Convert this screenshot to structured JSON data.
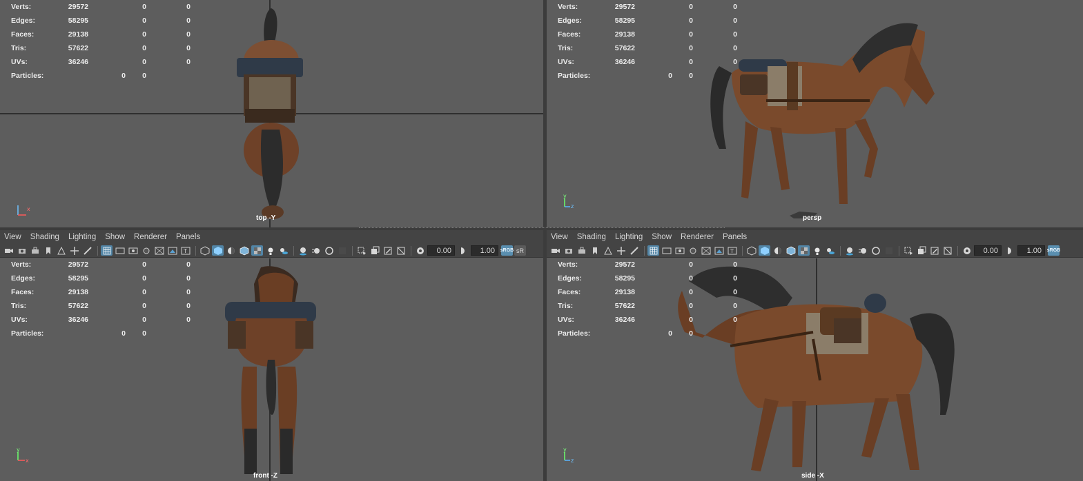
{
  "menu": [
    "View",
    "Shading",
    "Lighting",
    "Show",
    "Renderer",
    "Panels"
  ],
  "toolbar": {
    "exposure": "0.00",
    "gamma": "1.00",
    "badge": "sRGB",
    "sr_label": "sR"
  },
  "hud_labels": {
    "verts": "Verts:",
    "edges": "Edges:",
    "faces": "Faces:",
    "tris": "Tris:",
    "uvs": "UVs:",
    "particles": "Particles:"
  },
  "hud_values": {
    "verts": [
      "29572",
      "0",
      "0"
    ],
    "edges": [
      "58295",
      "0",
      "0"
    ],
    "faces": [
      "29138",
      "0",
      "0"
    ],
    "tris": [
      "57622",
      "0",
      "0"
    ],
    "uvs": [
      "36246",
      "0",
      "0"
    ],
    "particles": [
      "0",
      "0"
    ]
  },
  "viewports": {
    "top": "top -Y",
    "persp": "persp",
    "front": "front -Z",
    "side": "side -X"
  },
  "axis_labels": {
    "x": "x",
    "y": "y",
    "z": "z"
  },
  "colors": {
    "viewport_bg": "#5d5d5d",
    "panel_bg": "#444444",
    "horse_coat": "#7a4a2c",
    "mane": "#2b2b2b",
    "accent": "#5285a6"
  }
}
